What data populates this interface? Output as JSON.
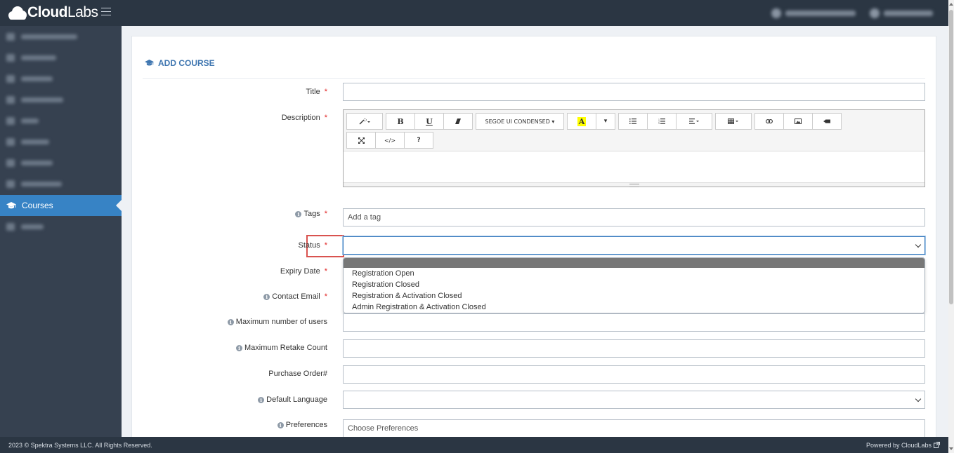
{
  "app": {
    "logo_bold": "Cloud",
    "logo_light": "Labs"
  },
  "sidebar": {
    "active_item": "Courses"
  },
  "page": {
    "title": "ADD COURSE"
  },
  "form": {
    "title_label": "Title",
    "description_label": "Description",
    "tags_label": "Tags",
    "tags_placeholder": "Add a tag",
    "status_label": "Status",
    "status_value": "",
    "status_options": [
      "Registration Open",
      "Registration Closed",
      "Registration & Activation Closed",
      "Admin Registration & Activation Closed"
    ],
    "expiry_label": "Expiry Date",
    "contact_label": "Contact Email",
    "max_users_label": "Maximum number of users",
    "max_retake_label": "Maximum Retake Count",
    "purchase_order_label": "Purchase Order#",
    "default_language_label": "Default Language",
    "preferences_label": "Preferences",
    "preferences_placeholder": "Choose Preferences",
    "required_marker": "*"
  },
  "editor": {
    "font_name": "SEGOE UI CONDENSED",
    "bold": "B",
    "underline": "U",
    "highlight": "A",
    "help": "?",
    "code": "</>"
  },
  "footer": {
    "copyright": "2023 © Spektra Systems LLC. All Rights Reserved.",
    "powered": "Powered by CloudLabs"
  },
  "colors": {
    "accent": "#3783c5",
    "sidebar_bg": "#364150",
    "topbar_bg": "#2b3643",
    "highlight_border": "#d9534f"
  }
}
